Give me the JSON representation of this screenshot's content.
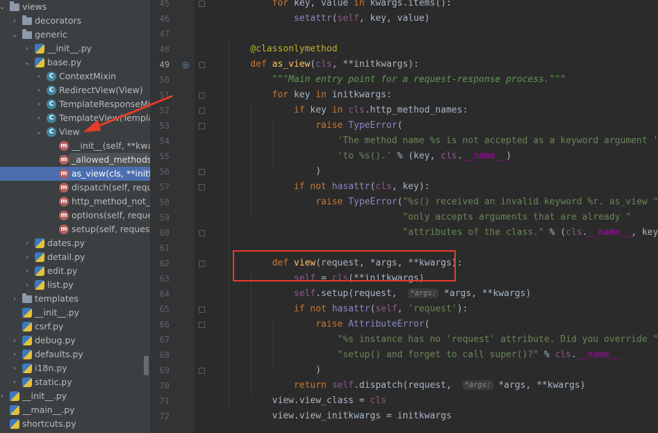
{
  "project_tree": {
    "items": [
      {
        "label": "views",
        "type": "folder",
        "level": 0,
        "expanded": true
      },
      {
        "label": "decorators",
        "type": "folder",
        "level": 1,
        "expanded": false
      },
      {
        "label": "generic",
        "type": "folder",
        "level": 1,
        "expanded": true
      },
      {
        "label": "__init__.py",
        "type": "py",
        "level": 2,
        "expanded": false
      },
      {
        "label": "base.py",
        "type": "py",
        "level": 2,
        "expanded": true
      },
      {
        "label": "ContextMixin",
        "type": "class",
        "level": 3,
        "expanded": false
      },
      {
        "label": "RedirectView(View)",
        "type": "class",
        "level": 3,
        "expanded": false
      },
      {
        "label": "TemplateResponseMixin",
        "type": "class",
        "level": 3,
        "expanded": false
      },
      {
        "label": "TemplateView(TemplateResponseMixin, ContextMixin, View)",
        "type": "class",
        "level": 3,
        "expanded": false
      },
      {
        "label": "View",
        "type": "class",
        "level": 3,
        "expanded": true
      },
      {
        "label": "__init__(self, **kwargs)",
        "type": "method",
        "level": 4
      },
      {
        "label": "_allowed_methods(self)",
        "type": "method",
        "level": 4
      },
      {
        "label": "as_view(cls, **initkwargs)",
        "type": "method",
        "level": 4,
        "selected": true
      },
      {
        "label": "dispatch(self, request, *args, **kwargs)",
        "type": "method",
        "level": 4
      },
      {
        "label": "http_method_not_allowed(self, request, *args, **kwargs)",
        "type": "method",
        "level": 4
      },
      {
        "label": "options(self, request, *args, **kwargs)",
        "type": "method",
        "level": 4
      },
      {
        "label": "setup(self, request, *args, **kwargs)",
        "type": "method",
        "level": 4
      },
      {
        "label": "dates.py",
        "type": "py",
        "level": 2,
        "expanded": false
      },
      {
        "label": "detail.py",
        "type": "py",
        "level": 2,
        "expanded": false
      },
      {
        "label": "edit.py",
        "type": "py",
        "level": 2,
        "expanded": false
      },
      {
        "label": "list.py",
        "type": "py",
        "level": 2,
        "expanded": false
      },
      {
        "label": "templates",
        "type": "folder",
        "level": 1,
        "expanded": false
      },
      {
        "label": "__init__.py",
        "type": "py",
        "level": 1,
        "noarrow": true
      },
      {
        "label": "csrf.py",
        "type": "py",
        "level": 1,
        "noarrow": true
      },
      {
        "label": "debug.py",
        "type": "py",
        "level": 1,
        "expanded": false
      },
      {
        "label": "defaults.py",
        "type": "py",
        "level": 1,
        "expanded": false
      },
      {
        "label": "i18n.py",
        "type": "py",
        "level": 1,
        "expanded": false
      },
      {
        "label": "static.py",
        "type": "py",
        "level": 1,
        "expanded": false
      },
      {
        "label": "__init__.py",
        "type": "py",
        "level": 0,
        "expanded": false
      },
      {
        "label": "__main__.py",
        "type": "py",
        "level": 0,
        "noarrow": true
      },
      {
        "label": "shortcuts.py",
        "type": "py",
        "level": 0,
        "noarrow": true
      }
    ],
    "tooltip": "_allowed_methods(self)"
  },
  "editor": {
    "lines": [
      {
        "n": "45",
        "tokens": [
          [
            "kw",
            "        for "
          ],
          [
            "tx",
            "key, value "
          ],
          [
            "kw",
            "in "
          ],
          [
            "tx",
            "kwargs.items():"
          ]
        ]
      },
      {
        "n": "46",
        "tokens": [
          [
            "tx",
            "            "
          ],
          [
            "bi",
            "setattr"
          ],
          [
            "tx",
            "("
          ],
          [
            "sf",
            "self"
          ],
          [
            "tx",
            ", key, value)"
          ]
        ]
      },
      {
        "n": "47",
        "tokens": []
      },
      {
        "n": "48",
        "tokens": [
          [
            "dec",
            "    @classonlymethod"
          ]
        ]
      },
      {
        "n": "49",
        "tokens": [
          [
            "kw",
            "    def "
          ],
          [
            "fn",
            "as_view"
          ],
          [
            "tx",
            "("
          ],
          [
            "sf",
            "cls"
          ],
          [
            "tx",
            ", **initkwargs):"
          ]
        ]
      },
      {
        "n": "50",
        "tokens": [
          [
            "doc",
            "        \"\"\"Main entry point for a request-response process.\"\"\""
          ]
        ]
      },
      {
        "n": "51",
        "tokens": [
          [
            "kw",
            "        for "
          ],
          [
            "tx",
            "key "
          ],
          [
            "kw",
            "in "
          ],
          [
            "tx",
            "initkwargs:"
          ]
        ]
      },
      {
        "n": "52",
        "tokens": [
          [
            "kw",
            "            if "
          ],
          [
            "tx",
            "key "
          ],
          [
            "kw",
            "in "
          ],
          [
            "sf",
            "cls"
          ],
          [
            "tx",
            ".http_method_names:"
          ]
        ]
      },
      {
        "n": "53",
        "tokens": [
          [
            "kw",
            "                raise "
          ],
          [
            "bi",
            "TypeError"
          ],
          [
            "tx",
            "("
          ]
        ]
      },
      {
        "n": "54",
        "tokens": [
          [
            "st",
            "                    'The method name %s is not accepted as a keyword argument '"
          ]
        ]
      },
      {
        "n": "55",
        "tokens": [
          [
            "st",
            "                    'to %s().'"
          ],
          [
            "tx",
            " % (key, "
          ],
          [
            "sf",
            "cls"
          ],
          [
            "tx",
            "."
          ],
          [
            "dn",
            "__name__"
          ],
          [
            "tx",
            ")"
          ]
        ]
      },
      {
        "n": "56",
        "tokens": [
          [
            "tx",
            "                )"
          ]
        ]
      },
      {
        "n": "57",
        "tokens": [
          [
            "kw",
            "            if not "
          ],
          [
            "bi",
            "hasattr"
          ],
          [
            "tx",
            "("
          ],
          [
            "sf",
            "cls"
          ],
          [
            "tx",
            ", key):"
          ]
        ]
      },
      {
        "n": "58",
        "tokens": [
          [
            "kw",
            "                raise "
          ],
          [
            "bi",
            "TypeError"
          ],
          [
            "tx",
            "("
          ],
          [
            "st",
            "\"%s() received an invalid keyword %r. as_view \""
          ]
        ]
      },
      {
        "n": "59",
        "tokens": [
          [
            "st",
            "                                \"only accepts arguments that are already \""
          ]
        ]
      },
      {
        "n": "60",
        "tokens": [
          [
            "st",
            "                                \"attributes of the class.\""
          ],
          [
            "tx",
            " % ("
          ],
          [
            "sf",
            "cls"
          ],
          [
            "tx",
            "."
          ],
          [
            "dn",
            "__name__"
          ],
          [
            "tx",
            ", key))"
          ]
        ]
      },
      {
        "n": "61",
        "tokens": []
      },
      {
        "n": "62",
        "tokens": [
          [
            "kw",
            "        def "
          ],
          [
            "fn",
            "view"
          ],
          [
            "tx",
            "(request, *args, **kwargs):"
          ]
        ]
      },
      {
        "n": "63",
        "tokens": [
          [
            "tx",
            "            "
          ],
          [
            "sf",
            "self"
          ],
          [
            "tx",
            " = "
          ],
          [
            "sf",
            "cls"
          ],
          [
            "tx",
            "(**initkwargs)"
          ]
        ]
      },
      {
        "n": "64",
        "tokens": [
          [
            "tx",
            "            "
          ],
          [
            "sf",
            "self"
          ],
          [
            "tx",
            ".setup(request,  "
          ],
          [
            "hint",
            "*args:"
          ],
          [
            "tx",
            " *args, **kwargs)"
          ]
        ]
      },
      {
        "n": "65",
        "tokens": [
          [
            "kw",
            "            if not "
          ],
          [
            "bi",
            "hasattr"
          ],
          [
            "tx",
            "("
          ],
          [
            "sf",
            "self"
          ],
          [
            "tx",
            ", "
          ],
          [
            "st",
            "'request'"
          ],
          [
            "tx",
            "):"
          ]
        ]
      },
      {
        "n": "66",
        "tokens": [
          [
            "kw",
            "                raise "
          ],
          [
            "bi",
            "AttributeError"
          ],
          [
            "tx",
            "("
          ]
        ]
      },
      {
        "n": "67",
        "tokens": [
          [
            "st",
            "                    \"%s instance has no 'request' attribute. Did you override \""
          ]
        ]
      },
      {
        "n": "68",
        "tokens": [
          [
            "st",
            "                    \"setup() and forget to call super()?\""
          ],
          [
            "tx",
            " % "
          ],
          [
            "sf",
            "cls"
          ],
          [
            "tx",
            "."
          ],
          [
            "dn",
            "__name__"
          ]
        ]
      },
      {
        "n": "69",
        "tokens": [
          [
            "tx",
            "                )"
          ]
        ]
      },
      {
        "n": "70",
        "tokens": [
          [
            "kw",
            "            return "
          ],
          [
            "sf",
            "self"
          ],
          [
            "tx",
            ".dispatch(request,  "
          ],
          [
            "hint",
            "*args:"
          ],
          [
            "tx",
            " *args, **kwargs)"
          ]
        ]
      },
      {
        "n": "71",
        "tokens": [
          [
            "tx",
            "        view.view_class = "
          ],
          [
            "sf",
            "cls"
          ]
        ]
      },
      {
        "n": "72",
        "tokens": [
          [
            "tx",
            "        view.view_initkwargs = initkwargs"
          ]
        ]
      }
    ],
    "current_line": "49"
  }
}
